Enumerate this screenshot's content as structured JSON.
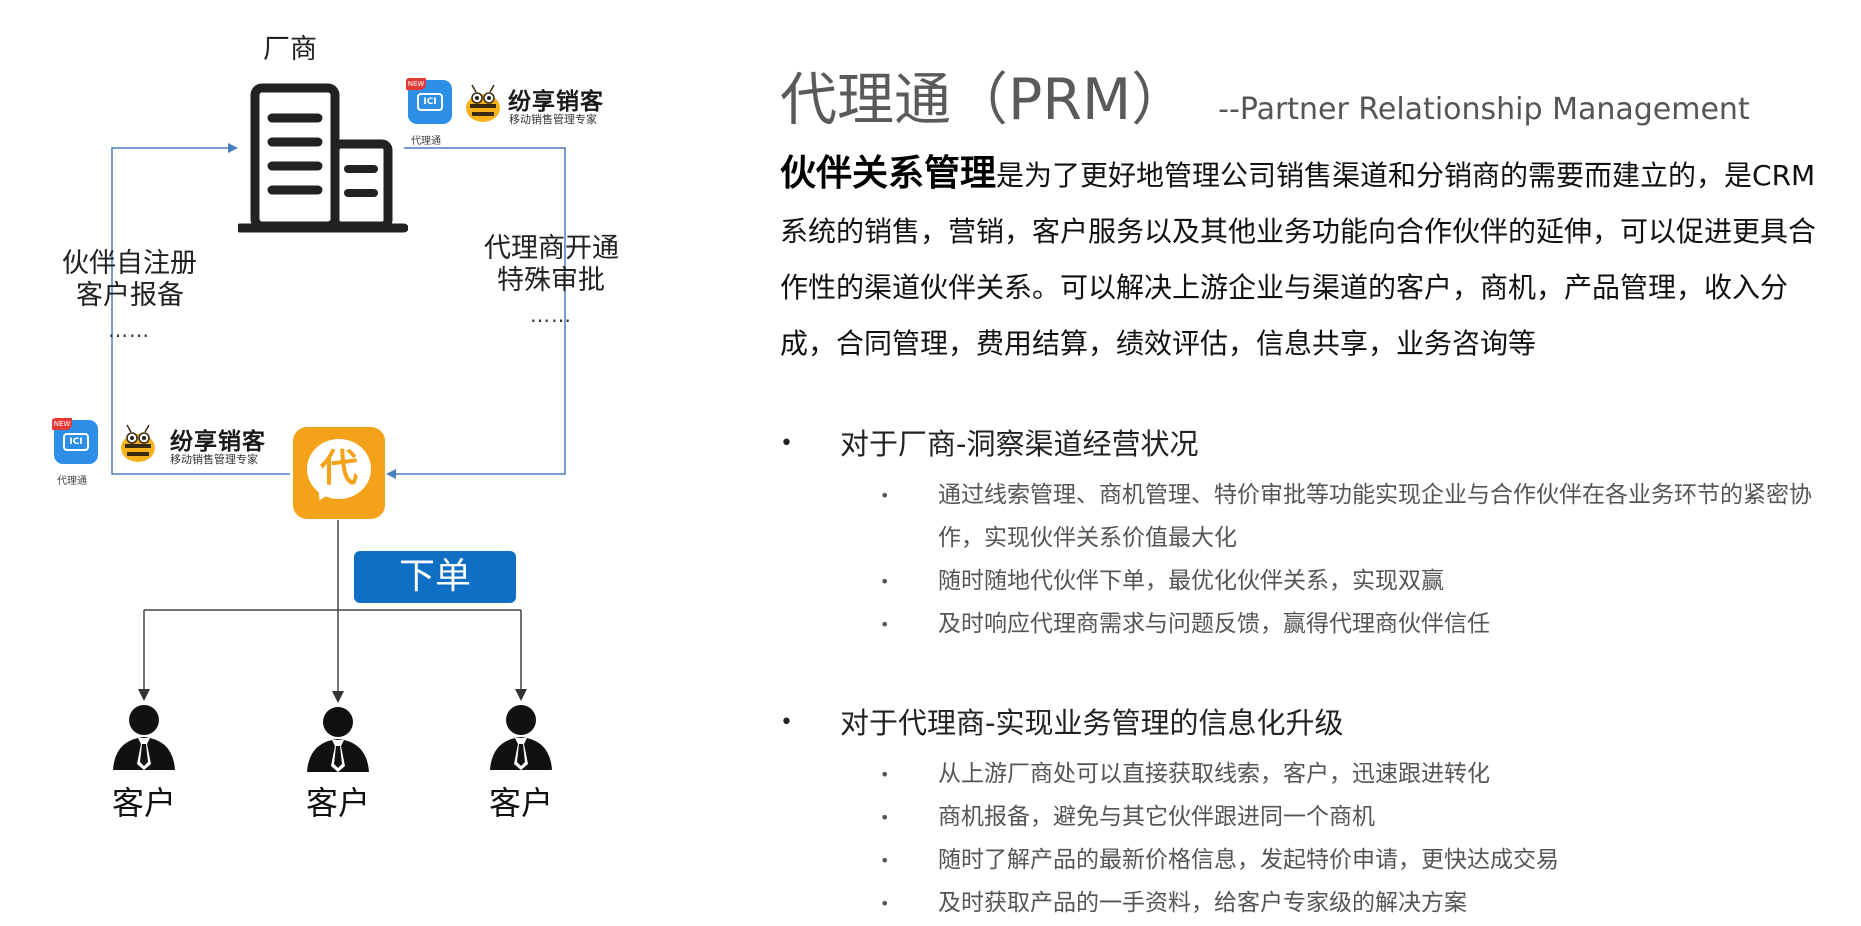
{
  "diagram": {
    "vendor_label": "厂商",
    "left_flow_label": [
      "伙伴自注册",
      "客户报备"
    ],
    "left_flow_ellipsis": "……",
    "right_flow_label": [
      "代理商开通",
      "特殊审批"
    ],
    "right_flow_ellipsis": "……",
    "brand": {
      "new_tag": "NEW",
      "app_caption": "代理通",
      "name": "纷享销客",
      "tagline": "移动销售管理专家"
    },
    "dai_char": "代",
    "order_button": "下单",
    "customers": [
      "客户",
      "客户",
      "客户"
    ],
    "colors": {
      "flow_line": "#4a7ebf",
      "order_button": "#0e6fc4",
      "agent_icon": "#f5a21b",
      "app_icon": "#2e8fe8"
    },
    "icons": [
      "building-icon",
      "app-icon",
      "bee-logo-icon",
      "agent-app-icon",
      "person-icon"
    ]
  },
  "content": {
    "title": "代理通（PRM）",
    "subtitle": "--Partner Relationship Management",
    "intro_lead": "伙伴关系管理",
    "intro_rest": "是为了更好地管理公司销售渠道和分销商的需要而建立的，是CRM系统的销售，营销，客户服务以及其他业务功能向合作伙伴的延伸，可以促进更具合作性的渠道伙伴关系。可以解决上游企业与渠道的客户，商机，产品管理，收入分成，合同管理，费用结算，绩效评估，信息共享，业务咨询等",
    "sections": [
      {
        "heading": "对于厂商-洞察渠道经营状况",
        "items": [
          "通过线索管理、商机管理、特价审批等功能实现企业与合作伙伴在各业务环节的紧密协作，实现伙伴关系价值最大化",
          "随时随地代伙伴下单，最优化伙伴关系，实现双赢",
          "及时响应代理商需求与问题反馈，赢得代理商伙伴信任"
        ]
      },
      {
        "heading": "对于代理商-实现业务管理的信息化升级",
        "items": [
          "从上游厂商处可以直接获取线索，客户，迅速跟进转化",
          "商机报备，避免与其它伙伴跟进同一个商机",
          "随时了解产品的最新价格信息，发起特价申请，更快达成交易",
          "及时获取产品的一手资料，给客户专家级的解决方案"
        ]
      }
    ]
  }
}
